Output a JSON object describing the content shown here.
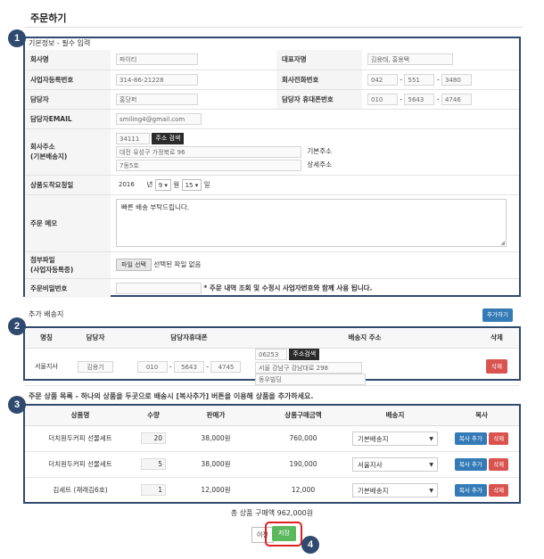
{
  "page": {
    "title": "주문하기"
  },
  "badges": [
    "1",
    "2",
    "3",
    "4"
  ],
  "basic": {
    "heading": "기본정보 - 필수 입력",
    "company_label": "회사명",
    "company_value": "파이티",
    "ceo_label": "대표자명",
    "ceo_value": "김용태, 홍용택",
    "bizno_label": "사업자등록번호",
    "bizno_value": "314-86-21228",
    "tel_label": "회사전화번호",
    "tel_1": "042",
    "tel_2": "551",
    "tel_3": "3480",
    "manager_label": "담당자",
    "manager_value": "홍당퍼",
    "mobile_label": "담당자 휴대폰번호",
    "mobile_1": "010",
    "mobile_2": "5643",
    "mobile_3": "4746",
    "email_label": "담당자EMAIL",
    "email_value": "smiling4@gmail.com",
    "address_label_1": "회사주소",
    "address_label_2": "(기본배송지)",
    "zip_value": "34111",
    "zip_button": "주소 검색",
    "address_value": "대전 유성구 가정북로 96",
    "address_detail_value": "7동5호",
    "address_basic_caption": "기본주소",
    "address_detail_caption": "상세주소",
    "date_label": "상품도착요청일",
    "date_year": "2016",
    "date_year_unit": "년",
    "date_month": "9",
    "date_month_unit": "월",
    "date_day": "15",
    "date_day_unit": "일",
    "memo_label": "주문 메모",
    "memo_value": "빠른 배송 부탁드립니다.",
    "attach_label_1": "첨부파일",
    "attach_label_2": "(사업자등록증)",
    "attach_button": "파일 선택",
    "attach_status": "선택된 파일 없음",
    "pw_label": "주문비밀번호",
    "pw_note": "* 주문 내역 조회 및 수정시 사업자번호와 함께 사용 됩니다."
  },
  "shipping": {
    "heading": "추가 배송지",
    "add_button": "추가하기",
    "columns": [
      "명칭",
      "담당자",
      "담당자휴대폰",
      "배송지 주소",
      "삭제"
    ],
    "rows": [
      {
        "name": "서울지사",
        "manager": "김용기",
        "m1": "010",
        "m2": "5643",
        "m3": "4745",
        "zip": "06253",
        "zip_button": "주소검색",
        "address": "서울 강남구 강남대로 298",
        "detail": "동우빌딩",
        "delete": "삭제"
      }
    ]
  },
  "items": {
    "heading": "주문 상품 목록 - 하나의 상품을 두곳으로 배송시 [복사추가] 버튼을 이용해 상품을 추가하세요.",
    "columns": [
      "상품명",
      "수량",
      "판매가",
      "상품구매금액",
      "배송지",
      "복사"
    ],
    "rows": [
      {
        "name": "더치원두커피 선물세트",
        "qty": "20",
        "price": "38,000원",
        "amount": "760,000",
        "dest": "기본배송지",
        "copy": "복사 추가",
        "delete": "삭제"
      },
      {
        "name": "더치원두커피 선물세트",
        "qty": "5",
        "price": "38,000원",
        "amount": "190,000",
        "dest": "서울지사",
        "copy": "복사 추가",
        "delete": "삭제"
      },
      {
        "name": "김세트 (재래김6호)",
        "qty": "1",
        "price": "12,000원",
        "amount": "12,000",
        "dest": "기본배송지",
        "copy": "복사 추가",
        "delete": "삭제"
      }
    ],
    "total": "총 상품 구매액 962,000원"
  },
  "footer": {
    "prev_button": "이전",
    "save_button": "저장"
  },
  "colors": {
    "box": "#2f4a6e",
    "blue": "#337ab7",
    "red": "#d9534f",
    "green": "#5cb85c",
    "highlight": "#e02020"
  }
}
